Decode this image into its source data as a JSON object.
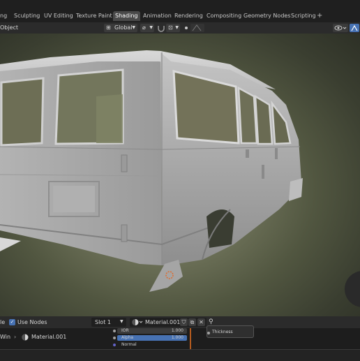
{
  "workspace_tabs": [
    "ng",
    "Sculpting",
    "UV Editing",
    "Texture Paint",
    "Shading",
    "Animation",
    "Rendering",
    "Compositing",
    "Geometry Nodes",
    "Scripting"
  ],
  "active_tab": "Shading",
  "add_workspace": "+",
  "viewport_header": {
    "object_label": "Object",
    "transform_orientation": "Global"
  },
  "node_editor_header": {
    "left_fragment": "le",
    "use_nodes_label": "Use Nodes",
    "use_nodes_checked": true,
    "slot_label": "Slot 1",
    "material_name": "Material.001"
  },
  "node_editor": {
    "left_fragment": "Win",
    "material_name": "Material.001",
    "rows": [
      {
        "label": "IOR",
        "value": "1.000"
      },
      {
        "label": "Alpha",
        "value": "1.000"
      },
      {
        "label": "Normal",
        "value": ""
      }
    ],
    "thickness_label": "Thickness"
  },
  "colors": {
    "accent_blue": "#4772b3",
    "active_tab_bg": "#4a4a4a",
    "wire_orange": "#b25a1f"
  }
}
